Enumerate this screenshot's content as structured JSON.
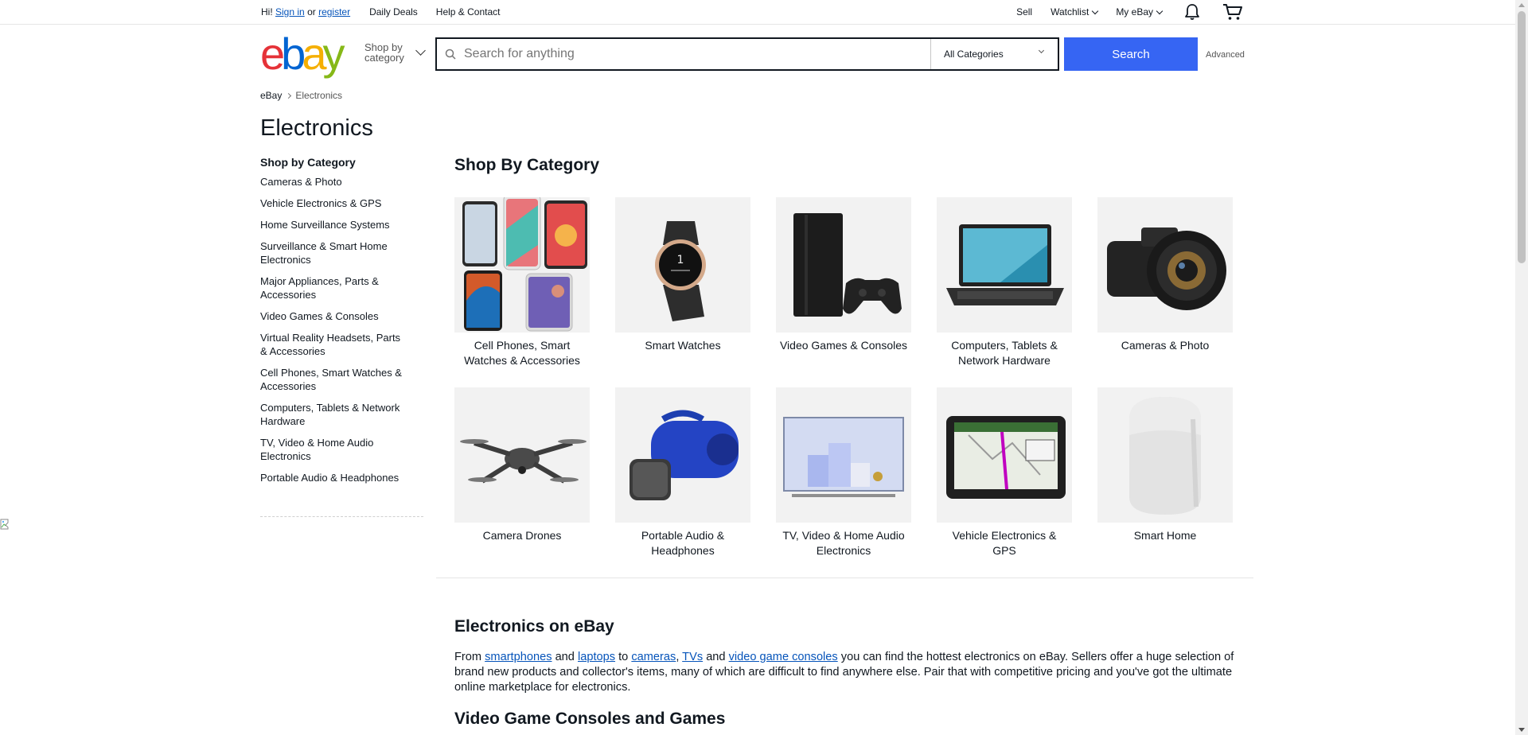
{
  "topbar": {
    "greeting_prefix": "Hi!",
    "sign_in": "Sign in",
    "or": "or",
    "register": "register",
    "daily_deals": "Daily Deals",
    "help_contact": "Help & Contact",
    "sell": "Sell",
    "watchlist": "Watchlist",
    "my_ebay": "My eBay",
    "bell_icon": "bell-icon",
    "cart_icon": "cart-icon"
  },
  "header": {
    "logo": {
      "e": "e",
      "b": "b",
      "a": "a",
      "y": "y"
    },
    "shop_by_category": "Shop by category",
    "search_placeholder": "Search for anything",
    "category_select": "All Categories",
    "search_button": "Search",
    "advanced": "Advanced"
  },
  "breadcrumb": {
    "home": "eBay",
    "current": "Electronics"
  },
  "page_title": "Electronics",
  "sidebar": {
    "heading": "Shop by Category",
    "items": [
      "Cameras & Photo",
      "Vehicle Electronics & GPS",
      "Home Surveillance Systems",
      "Surveillance & Smart Home Electronics",
      "Major Appliances, Parts & Accessories",
      "Video Games & Consoles",
      "Virtual Reality Headsets, Parts & Accessories",
      "Cell Phones, Smart Watches & Accessories",
      "Computers, Tablets & Network Hardware",
      "TV, Video & Home Audio Electronics",
      "Portable Audio & Headphones"
    ]
  },
  "main": {
    "shop_by_category_title": "Shop By Category",
    "categories": [
      {
        "label": "Cell Phones, Smart Watches & Accessories",
        "icon": "phones-image"
      },
      {
        "label": "Smart Watches",
        "icon": "smartwatch-image"
      },
      {
        "label": "Video Games & Consoles",
        "icon": "console-image"
      },
      {
        "label": "Computers, Tablets & Network Hardware",
        "icon": "laptop-image"
      },
      {
        "label": "Cameras & Photo",
        "icon": "camera-image"
      },
      {
        "label": "Camera Drones",
        "icon": "drone-image"
      },
      {
        "label": "Portable Audio & Headphones",
        "icon": "speaker-image"
      },
      {
        "label": "TV, Video & Home Audio Electronics",
        "icon": "tv-image"
      },
      {
        "label": "Vehicle Electronics & GPS",
        "icon": "gps-image"
      },
      {
        "label": "Smart Home",
        "icon": "smart-speaker-image"
      }
    ],
    "electronics_title": "Electronics on eBay",
    "para": {
      "from": "From",
      "smartphones": "smartphones",
      "and1": "and",
      "laptops": "laptops",
      "to": "to",
      "cameras": "cameras",
      "comma": ",",
      "tvs": "TVs",
      "and2": "and",
      "consoles": "video game consoles",
      "rest": "you can find the hottest electronics on eBay. Sellers offer a huge selection of brand new products and collector's items, many of which are difficult to find anywhere else. Pair that with competitive pricing and you've got the ultimate online marketplace for electronics."
    },
    "consoles_title": "Video Game Consoles and Games"
  }
}
